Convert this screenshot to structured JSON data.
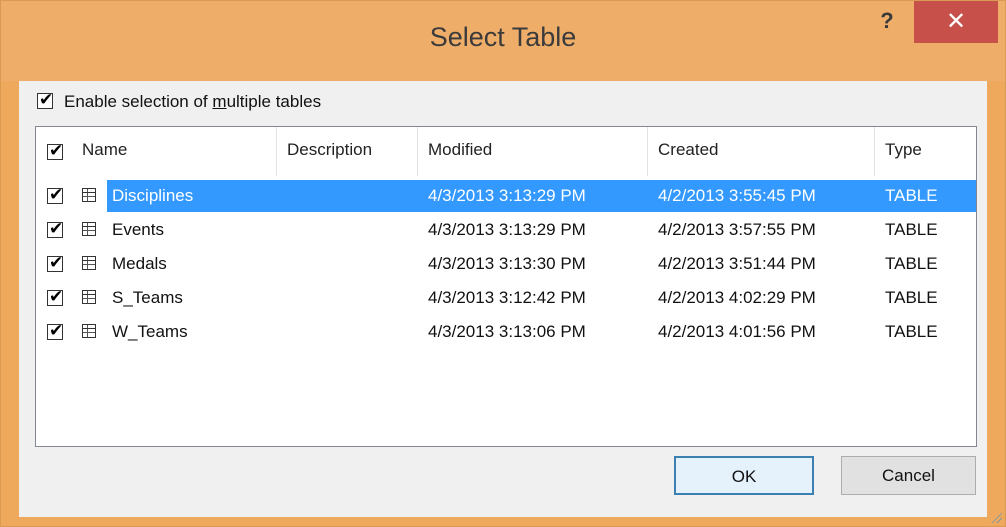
{
  "window": {
    "title": "Select Table",
    "help_label": "?",
    "close_label": "✕"
  },
  "options": {
    "enable_multi_prefix": "Enable selection of ",
    "enable_multi_underlined": "m",
    "enable_multi_suffix": "ultiple tables",
    "enable_multi_checked": true
  },
  "table": {
    "columns": [
      "Name",
      "Description",
      "Modified",
      "Created",
      "Type"
    ],
    "header_checked": true,
    "rows": [
      {
        "checked": true,
        "name": "Disciplines",
        "description": "",
        "modified": "4/3/2013 3:13:29 PM",
        "created": "4/2/2013 3:55:45 PM",
        "type": "TABLE",
        "selected": true
      },
      {
        "checked": true,
        "name": "Events",
        "description": "",
        "modified": "4/3/2013 3:13:29 PM",
        "created": "4/2/2013 3:57:55 PM",
        "type": "TABLE",
        "selected": false
      },
      {
        "checked": true,
        "name": "Medals",
        "description": "",
        "modified": "4/3/2013 3:13:30 PM",
        "created": "4/2/2013 3:51:44 PM",
        "type": "TABLE",
        "selected": false
      },
      {
        "checked": true,
        "name": "S_Teams",
        "description": "",
        "modified": "4/3/2013 3:12:42 PM",
        "created": "4/2/2013 4:02:29 PM",
        "type": "TABLE",
        "selected": false
      },
      {
        "checked": true,
        "name": "W_Teams",
        "description": "",
        "modified": "4/3/2013 3:13:06 PM",
        "created": "4/2/2013 4:01:56 PM",
        "type": "TABLE",
        "selected": false
      }
    ]
  },
  "scrollbar": {
    "left_arrow": "<",
    "right_arrow": ">"
  },
  "buttons": {
    "ok": "OK",
    "cancel": "Cancel"
  },
  "colors": {
    "title_bar": "#eeae69",
    "close_button": "#c7504a",
    "selection": "#3399ff"
  },
  "icons": {
    "table_row": "table-icon",
    "check": "checkmark-icon",
    "close": "close-icon",
    "help": "help-icon"
  }
}
